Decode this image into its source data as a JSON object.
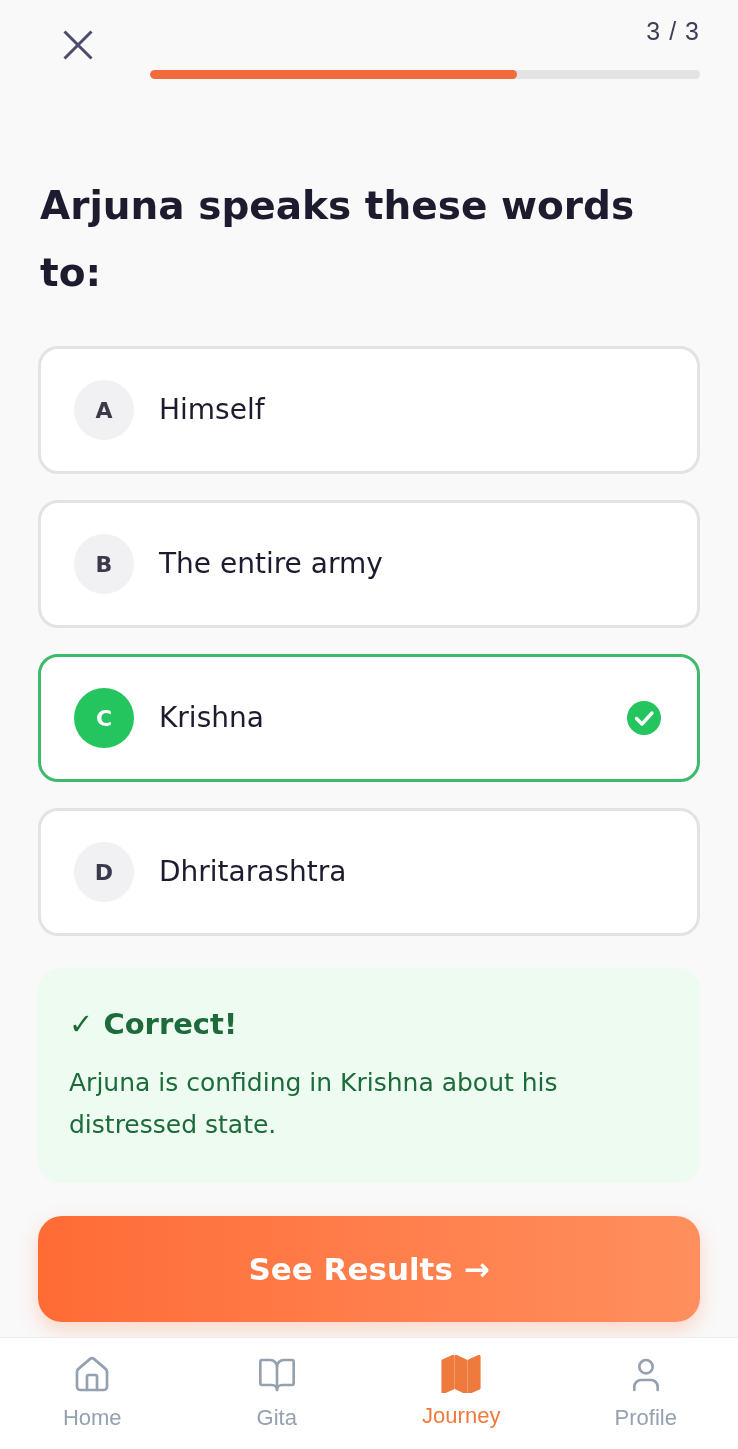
{
  "header": {
    "counter": "3 / 3",
    "progress": {
      "level": 0.667
    }
  },
  "question": "Arjuna speaks these words to:",
  "options": [
    {
      "letter": "A",
      "text": "Himself",
      "selected": false,
      "correct": false
    },
    {
      "letter": "B",
      "text": "The entire army",
      "selected": false,
      "correct": false
    },
    {
      "letter": "C",
      "text": "Krishna",
      "selected": true,
      "correct": true
    },
    {
      "letter": "D",
      "text": "Dhritarashtra",
      "selected": false,
      "correct": false
    }
  ],
  "feedback": {
    "kind": "correct",
    "title": "✓ Correct!",
    "text": "Arjuna is confiding in Krishna about his distressed state."
  },
  "primary_button": {
    "label": "See Results →"
  },
  "bottom_nav": [
    {
      "label": "Home",
      "selected": false
    },
    {
      "label": "Gita",
      "selected": false
    },
    {
      "label": "Journey",
      "selected": true
    },
    {
      "label": "Profile",
      "selected": false
    }
  ]
}
